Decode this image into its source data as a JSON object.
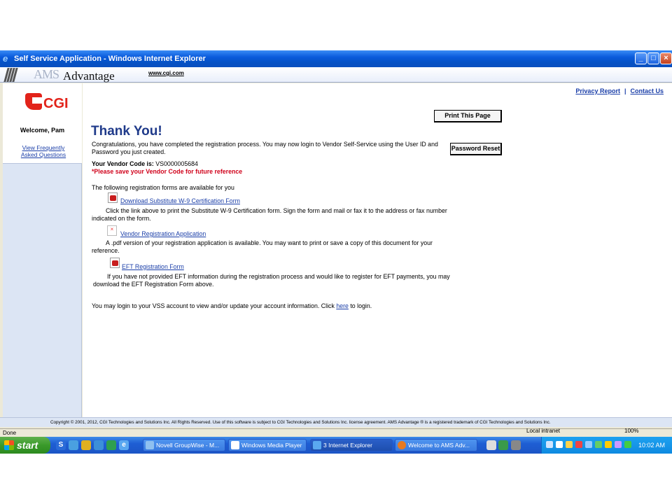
{
  "window": {
    "title": "Self Service Application - Windows Internet Explorer"
  },
  "header": {
    "ams_text": "AMS",
    "advantage_text": "Advantage",
    "site_link": "www.cgi.com"
  },
  "sidebar": {
    "logo_text": "CGI",
    "welcome": "Welcome, Pam",
    "faq_link": "View Frequently Asked Questions"
  },
  "top_links": {
    "privacy": "Privacy Report",
    "separator": "|",
    "contact": "Contact Us"
  },
  "buttons": {
    "print": "Print This Page",
    "password_reset": "Password Reset"
  },
  "main": {
    "heading": "Thank You!",
    "congrats": "Congratulations, you have completed the registration process. You may now login to Vendor Self-Service using the User ID and Password you just created.",
    "vendor_code_label": "Your Vendor Code is:",
    "vendor_code_value": "VS0000005684",
    "save_note": "*Please save your Vendor Code for future reference",
    "forms_intro": "The following registration forms are available for you",
    "w9_link": "Download Substitute W-9 Certification Form",
    "w9_desc": "Click the link above to print the Substitute W-9 Certification form. Sign the form and mail or fax it to the address or fax number indicated on the form.",
    "vra_link": "Vendor Registration Application",
    "vra_desc": "A .pdf version of your registration application is available. You may want to print or save a copy of this document for your reference.",
    "eft_link": "EFT Registration Form",
    "eft_desc": "If you have not provided EFT information during the registration process and would like to register for EFT payments, you may download the EFT Registration Form above.",
    "login_before": "You may login to your VSS account to view and/or update your account information. Click ",
    "login_here": "here",
    "login_after": " to login."
  },
  "footer": {
    "text": "Copyright © 2001, 2012, CGI Technologies and Solutions Inc. All Rights Reserved. Use of this software is subject to CGI Technologies and Solutions Inc. license agreement.    AMS Advantage ® is a registered trademark of CGI Technologies and Solutions Inc."
  },
  "statusbar": {
    "status": "Done",
    "zone": "Local intranet",
    "zoom": "100%"
  },
  "taskbar": {
    "start": "start",
    "tasks": [
      {
        "label": "Novell GroupWise - M..."
      },
      {
        "label": "Windows Media Player"
      },
      {
        "label": "3 Internet Explorer"
      },
      {
        "label": "Welcome to AMS Adv..."
      }
    ],
    "clock": "10:02 AM"
  },
  "colors": {
    "link": "#1a3ea8",
    "heading": "#1f3a8a",
    "alert": "#d0021b",
    "brand": "#e2231a",
    "sidebar_bg": "#dce5f4"
  }
}
